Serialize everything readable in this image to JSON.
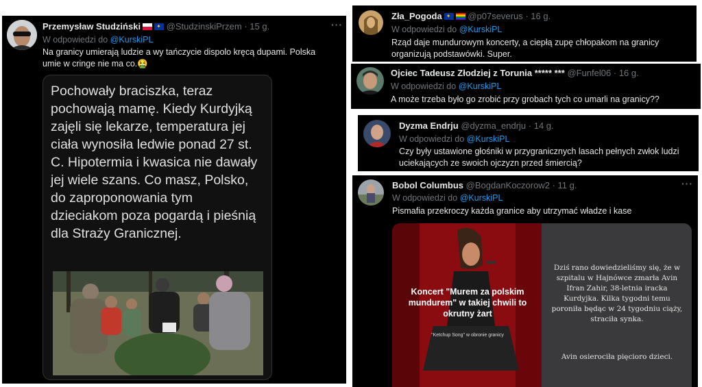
{
  "tweets": [
    {
      "name": "Przemysław Studziński",
      "handle": "@StudzinskiPrzem",
      "time": "· 15 g.",
      "reply_prefix": "W odpowiedzi do",
      "reply_to": "@KurskiPL",
      "text": "Na granicy umierają ludzie a wy tańczycie dispolo kręcą dupami. Polska umie w cringe nie ma co.",
      "emoji": "🤮",
      "quote_text": "Pochowały braciszka, teraz pochowają mamę.  Kiedy Kurdyjką zajęli się  lekarze, temperatura jej ciała wynosiła ledwie ponad 27 st. C. Hipotermia i kwasica nie dawały jej wiele szans. Co masz, Polsko, do zaproponowania tym dzieciakom poza pogardą  i pieśnią dla Straży Granicznej."
    },
    {
      "name": "Zła_Pogoda",
      "handle": "@p07severus",
      "time": "· 16 g.",
      "reply_prefix": "W odpowiedzi do",
      "reply_to": "@KurskiPL",
      "text": "Rząd daje mundurowym koncerty, a ciepłą zupę chłopakom na granicy organizują podstawówki. Super."
    },
    {
      "name": "Ojciec Tadeusz Złodziej z Torunia",
      "stars": "***** ***",
      "handle": "@Funfel06",
      "time": "· 16 g.",
      "reply_prefix": "W odpowiedzi do",
      "reply_to": "@KurskiPL",
      "text": "A może trzeba było go zrobić przy grobach tych co umarli na granicy??"
    },
    {
      "name": "Dyzma Endrju",
      "handle": "@dyzma_endrju",
      "time": "· 14 g.",
      "reply_prefix": "W odpowiedzi do",
      "reply_to": "@KurskiPL",
      "text": "Czy były ustawione głośniki w przygranicznych lasach pełnych zwłok ludzi uciekających ze swoich ojczyzn przed śmiercią?"
    },
    {
      "name": "Bobol Columbus",
      "handle": "@BogdanKoczorow2",
      "time": "· 11 g.",
      "reply_prefix": "W odpowiedzi do",
      "reply_to": "@KurskiPL",
      "text": "Pismafia przekroczy każda granice aby utrzymać władze i kase",
      "image_left_caption": "Koncert \"Murem za polskim mundurem\" w takiej chwili to okrutny żart",
      "image_left_small": "\"Ketchup Song\" w obronie granicy",
      "image_right_text": "Dziś rano dowiedzieliśmy się, że w szpitalu w Hajnówce zmarła Avin Ifran Zahir, 38-letnia iracka Kurdyjka. Kilka tygodni temu poroniła będąc w 24 tygodniu ciąży, straciła synka.",
      "image_right_text2": "Avin osierociła pięcioro dzieci."
    }
  ],
  "more_glyph": "···",
  "colors": {
    "bg": "#000000",
    "text": "#e7e9ea",
    "muted": "#71767b",
    "link": "#1d9bf0"
  }
}
